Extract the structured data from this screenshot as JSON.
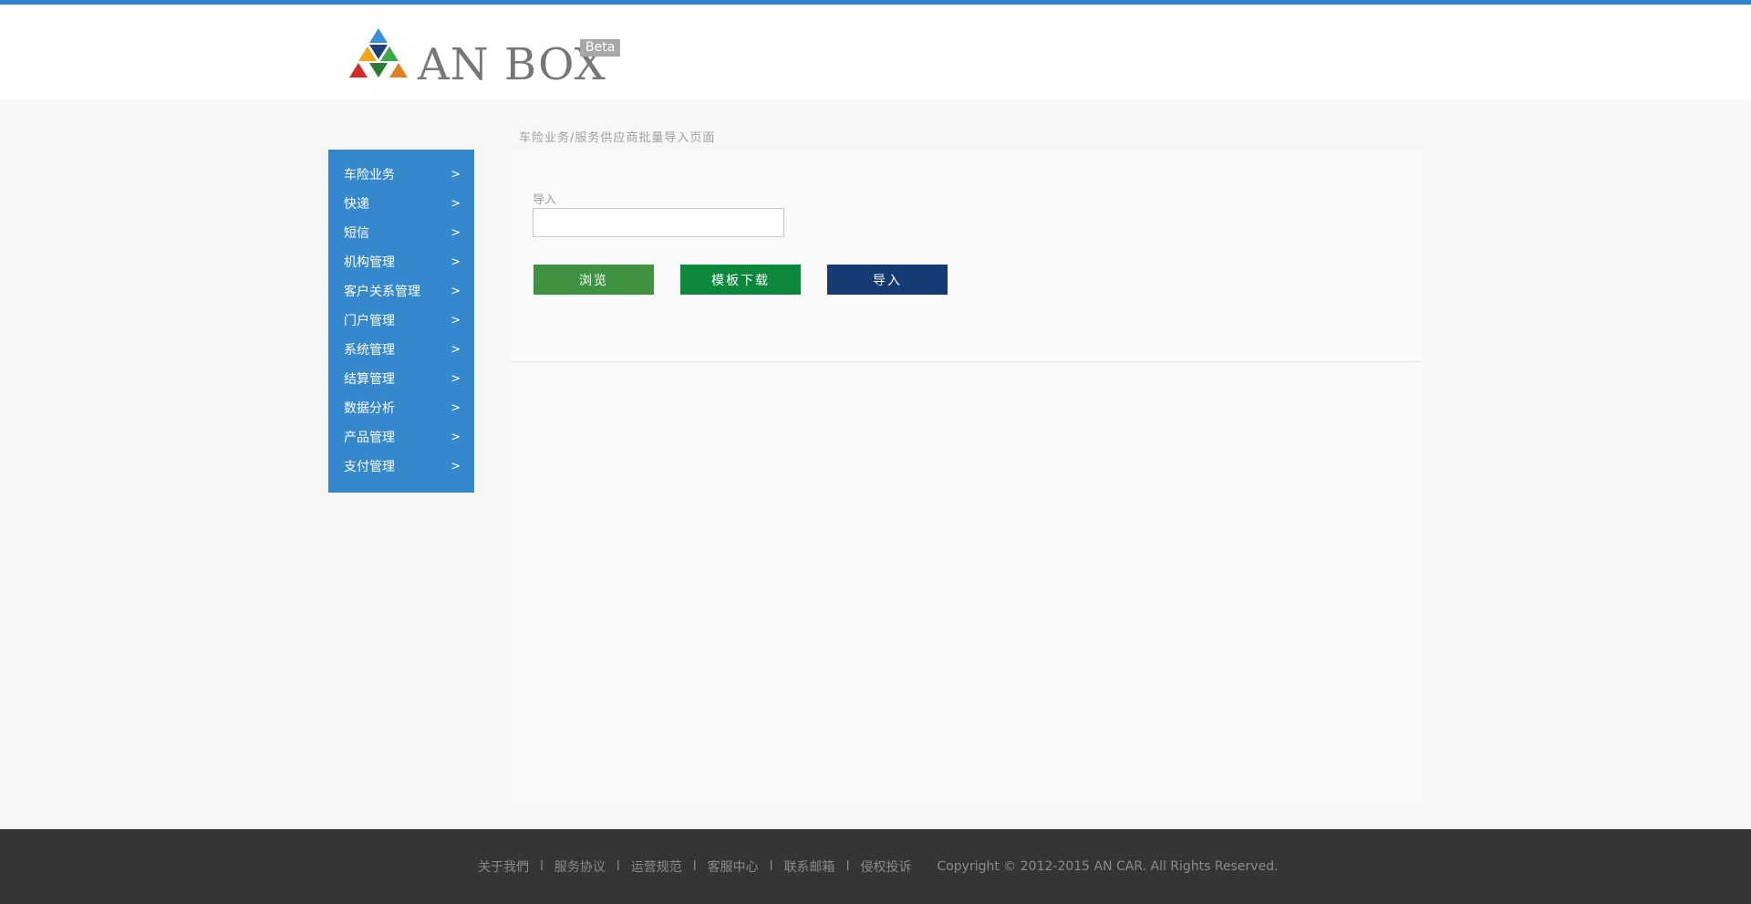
{
  "header": {
    "logo_text": "AN BOX",
    "badge": "Beta",
    "accent_color": "#2f86cc"
  },
  "sidebar": {
    "items": [
      {
        "label": "车险业务",
        "arrow": ">"
      },
      {
        "label": "快递",
        "arrow": ">"
      },
      {
        "label": "短信",
        "arrow": ">"
      },
      {
        "label": "机构管理",
        "arrow": ">"
      },
      {
        "label": "客户关系管理",
        "arrow": ">"
      },
      {
        "label": "门户管理",
        "arrow": ">"
      },
      {
        "label": "系统管理",
        "arrow": ">"
      },
      {
        "label": "结算管理",
        "arrow": ">"
      },
      {
        "label": "数据分析",
        "arrow": ">"
      },
      {
        "label": "产品管理",
        "arrow": ">"
      },
      {
        "label": "支付管理",
        "arrow": ">"
      }
    ]
  },
  "main": {
    "breadcrumb": "车险业务/服务供应商批量导入页面",
    "import_label": "导入",
    "import_value": "",
    "buttons": {
      "browse": "浏览",
      "template_download": "模板下载",
      "import": "导入"
    }
  },
  "footer": {
    "links": [
      "关于我們",
      "服务协议",
      "运营规范",
      "客服中心",
      "联系邮箱",
      "侵权投诉"
    ],
    "separator": "l",
    "copyright": "Copyright © 2012-2015 AN CAR.  All Rights Reserved."
  }
}
